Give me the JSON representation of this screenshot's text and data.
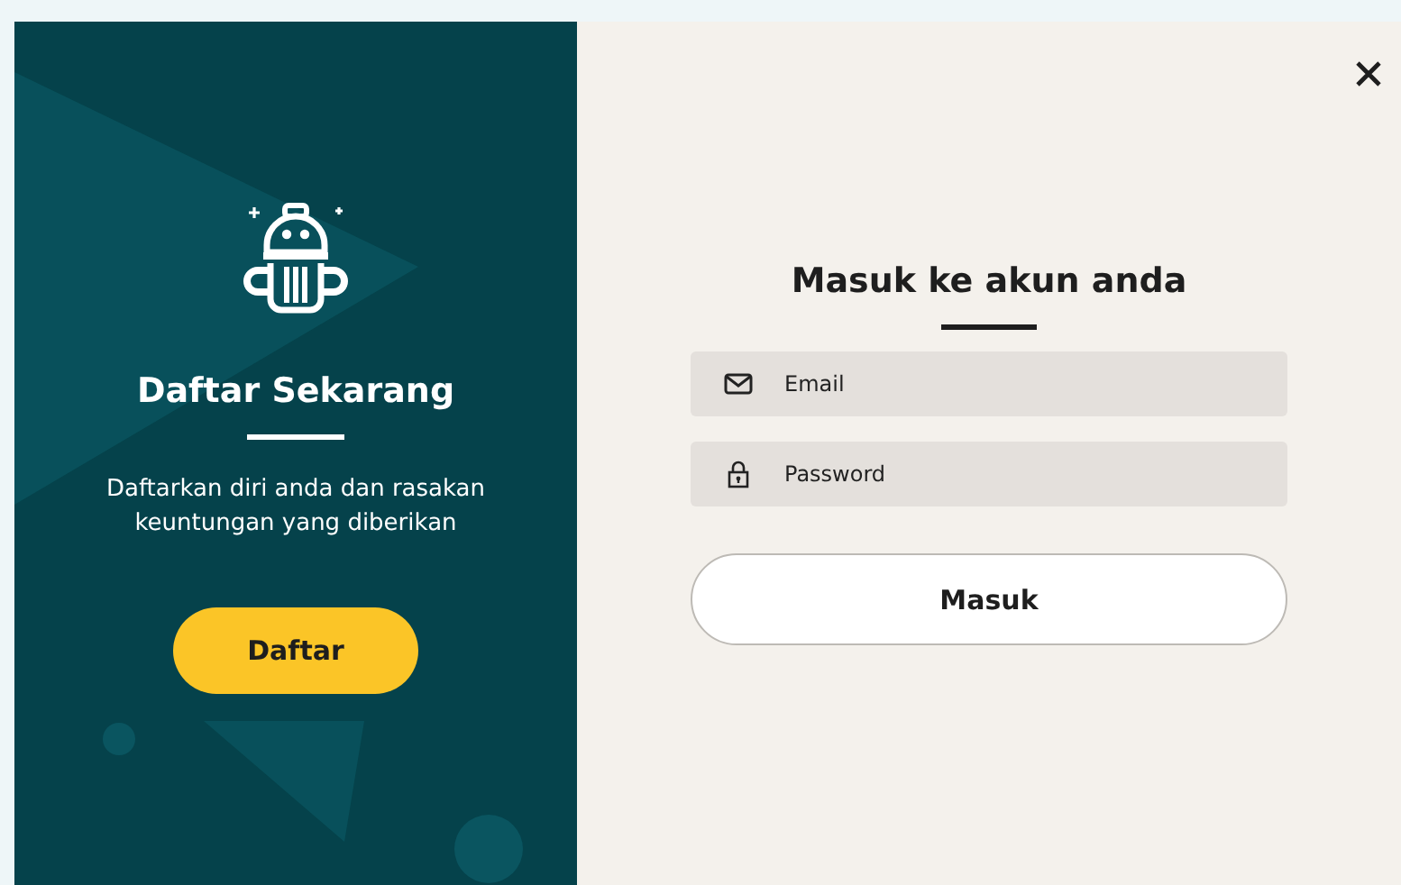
{
  "signup_panel": {
    "title": "Daftar Sekarang",
    "description": "Daftarkan diri anda dan rasakan keuntungan yang diberikan",
    "button": "Daftar"
  },
  "login_panel": {
    "title": "Masuk ke akun anda",
    "fields": [
      {
        "kind": "email",
        "placeholder": "Email"
      },
      {
        "kind": "password",
        "placeholder": "Password"
      }
    ],
    "button": "Masuk"
  }
}
